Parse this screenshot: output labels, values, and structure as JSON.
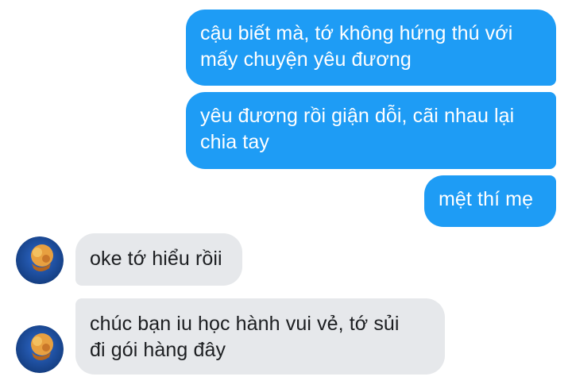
{
  "messages": {
    "outgoing": [
      {
        "text": "cậu biết mà, tớ không hứng thú với\nmấy chuyện yêu đương"
      },
      {
        "text": "yêu đương rồi giận dỗi, cãi nhau lại\nchia tay"
      },
      {
        "text": "mệt thí mẹ"
      }
    ],
    "incoming": [
      {
        "text": "oke tớ hiểu rồii"
      },
      {
        "text": "chúc bạn iu học hành vui vẻ, tớ sủi\nđi gói hàng đây"
      }
    ]
  },
  "colors": {
    "outgoing_bubble": "#1e9cf5",
    "incoming_bubble": "#e6e8eb",
    "avatar_background": "#1a4fa0",
    "avatar_figure": "#e8a040"
  },
  "icons": {
    "avatar": "contact-avatar-icon"
  }
}
